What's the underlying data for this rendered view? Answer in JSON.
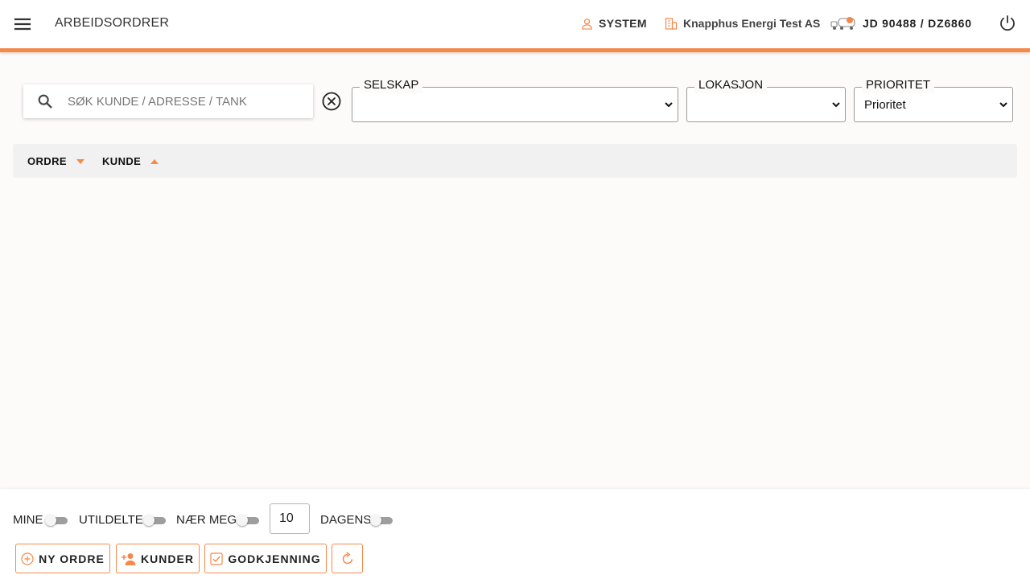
{
  "header": {
    "title": "ARBEIDSORDRER",
    "user": "SYSTEM",
    "company": "Knapphus Energi Test AS",
    "vehicle": "JD 90488 / DZ6860",
    "accent_color": "#f5894a"
  },
  "filters": {
    "search_placeholder": "SØK KUNDE / ADRESSE / TANK",
    "search_value": "",
    "selskap_label": "SELSKAP",
    "selskap_value": "",
    "lokasjon_label": "LOKASJON",
    "lokasjon_value": "",
    "prioritet_label": "PRIORITET",
    "prioritet_value": "Prioritet"
  },
  "table": {
    "columns": [
      {
        "label": "ORDRE",
        "sort": "descending"
      },
      {
        "label": "KUNDE",
        "sort": "ascending"
      }
    ],
    "rows": []
  },
  "footer": {
    "toggles": {
      "mine": {
        "label": "MINE",
        "on": false
      },
      "utildelte": {
        "label": "UTILDELTE",
        "on": false
      },
      "naer_meg": {
        "label": "NÆR MEG",
        "on": false
      },
      "dagens": {
        "label": "DAGENS",
        "on": false
      }
    },
    "count_value": "10",
    "buttons": {
      "ny_ordre": "NY ORDRE",
      "kunder": "KUNDER",
      "godkjenning": "GODKJENNING"
    }
  },
  "icons": {
    "menu": "menu-icon",
    "user": "user-icon",
    "company": "building-icon",
    "vehicle": "truck-icon",
    "power": "power-icon",
    "search": "search-icon",
    "clear": "clear-circle-icon",
    "add": "add-circle-icon",
    "add_user": "add-user-icon",
    "approve": "checkbox-icon",
    "refresh": "refresh-icon"
  }
}
